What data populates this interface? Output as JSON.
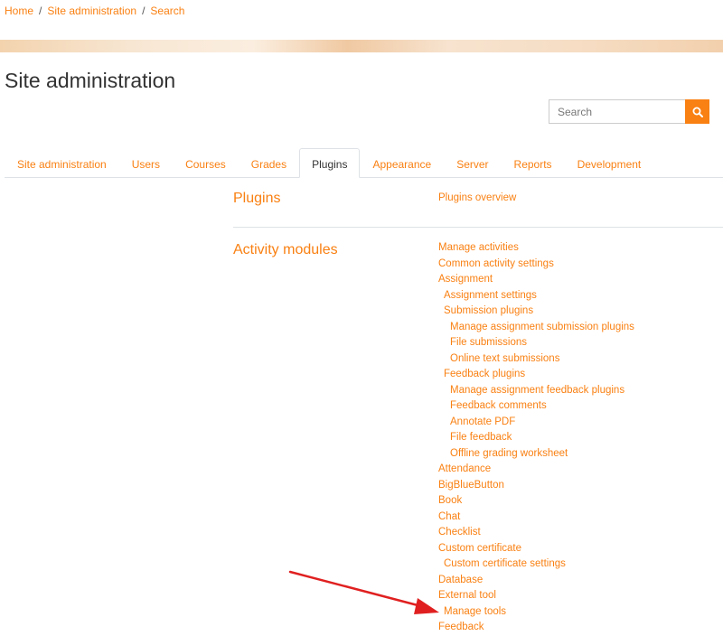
{
  "breadcrumb": {
    "home": "Home",
    "site_admin": "Site administration",
    "search": "Search",
    "separator": "/"
  },
  "page_title": "Site administration",
  "search": {
    "placeholder": "Search"
  },
  "tabs": [
    {
      "label": "Site administration"
    },
    {
      "label": "Users"
    },
    {
      "label": "Courses"
    },
    {
      "label": "Grades"
    },
    {
      "label": "Plugins",
      "active": true
    },
    {
      "label": "Appearance"
    },
    {
      "label": "Server"
    },
    {
      "label": "Reports"
    },
    {
      "label": "Development"
    }
  ],
  "sections": {
    "plugins": {
      "heading": "Plugins",
      "links": [
        "Plugins overview"
      ]
    },
    "activity_modules": {
      "heading": "Activity modules",
      "links": [
        "Manage activities",
        "Common activity settings",
        "Assignment",
        "Assignment settings",
        "Submission plugins",
        "Manage assignment submission plugins",
        "File submissions",
        "Online text submissions",
        "Feedback plugins",
        "Manage assignment feedback plugins",
        "Feedback comments",
        "Annotate PDF",
        "File feedback",
        "Offline grading worksheet",
        "Attendance",
        "BigBlueButton",
        "Book",
        "Chat",
        "Checklist",
        "Custom certificate",
        "Custom certificate settings",
        "Database",
        "External tool",
        "Manage tools",
        "Feedback"
      ]
    }
  },
  "colors": {
    "accent": "#f98012",
    "annotation_arrow": "#e02020"
  },
  "icons": {
    "search_button": "search-icon"
  }
}
